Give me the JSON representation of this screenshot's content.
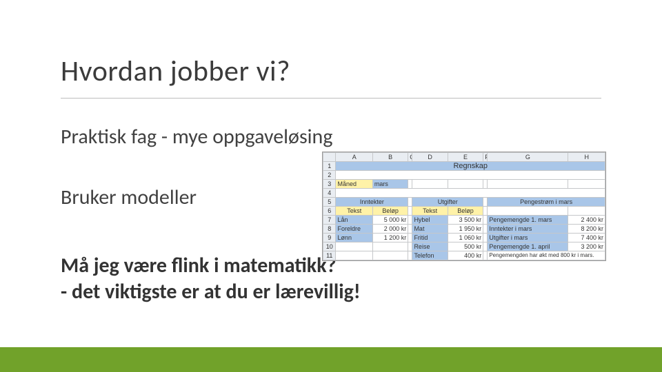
{
  "title": "Hvordan jobber vi?",
  "p1": "Praktisk fag - mye oppgaveløsing",
  "p2": "Bruker modeller",
  "p3": "Må jeg være flink i matematikk?",
  "p4": "- det viktigste er at du er lærevillig!",
  "sheet": {
    "cols": [
      "A",
      "B",
      "C",
      "D",
      "E",
      "F",
      "G",
      "H"
    ],
    "rows": [
      "1",
      "2",
      "3",
      "4",
      "5",
      "6",
      "7",
      "8",
      "9",
      "10",
      "11"
    ],
    "r1_title": "Regnskap",
    "r3_label": "Måned",
    "r3_value": "mars",
    "r5_col1": "Inntekter",
    "r5_col2": "Utgifter",
    "r5_col3": "Pengestrøm i mars",
    "r6_l1": "Tekst",
    "r6_l2": "Beløp",
    "r6_l3": "Tekst",
    "r6_l4": "Beløp",
    "r7": {
      "a": "Lån",
      "b": "5 000 kr",
      "d": "Hybel",
      "e": "3 500 kr",
      "g": "Pengemengde 1. mars",
      "h": "2 400 kr"
    },
    "r8": {
      "a": "Foreldre",
      "b": "2 000 kr",
      "d": "Mat",
      "e": "1 950 kr",
      "g": "Inntekter i mars",
      "h": "8 200 kr"
    },
    "r9": {
      "a": "Lønn",
      "b": "1 200 kr",
      "d": "Fritid",
      "e": "1 060 kr",
      "g": "Utgifter i mars",
      "h": "7 400 kr"
    },
    "r10": {
      "d": "Reise",
      "e": "500 kr",
      "g": "Pengemengde 1. april",
      "h": "3 200 kr"
    },
    "r11": {
      "d": "Telefon",
      "e": "400 kr",
      "g": "Pengemengden har økt med 800 kr i mars."
    }
  }
}
